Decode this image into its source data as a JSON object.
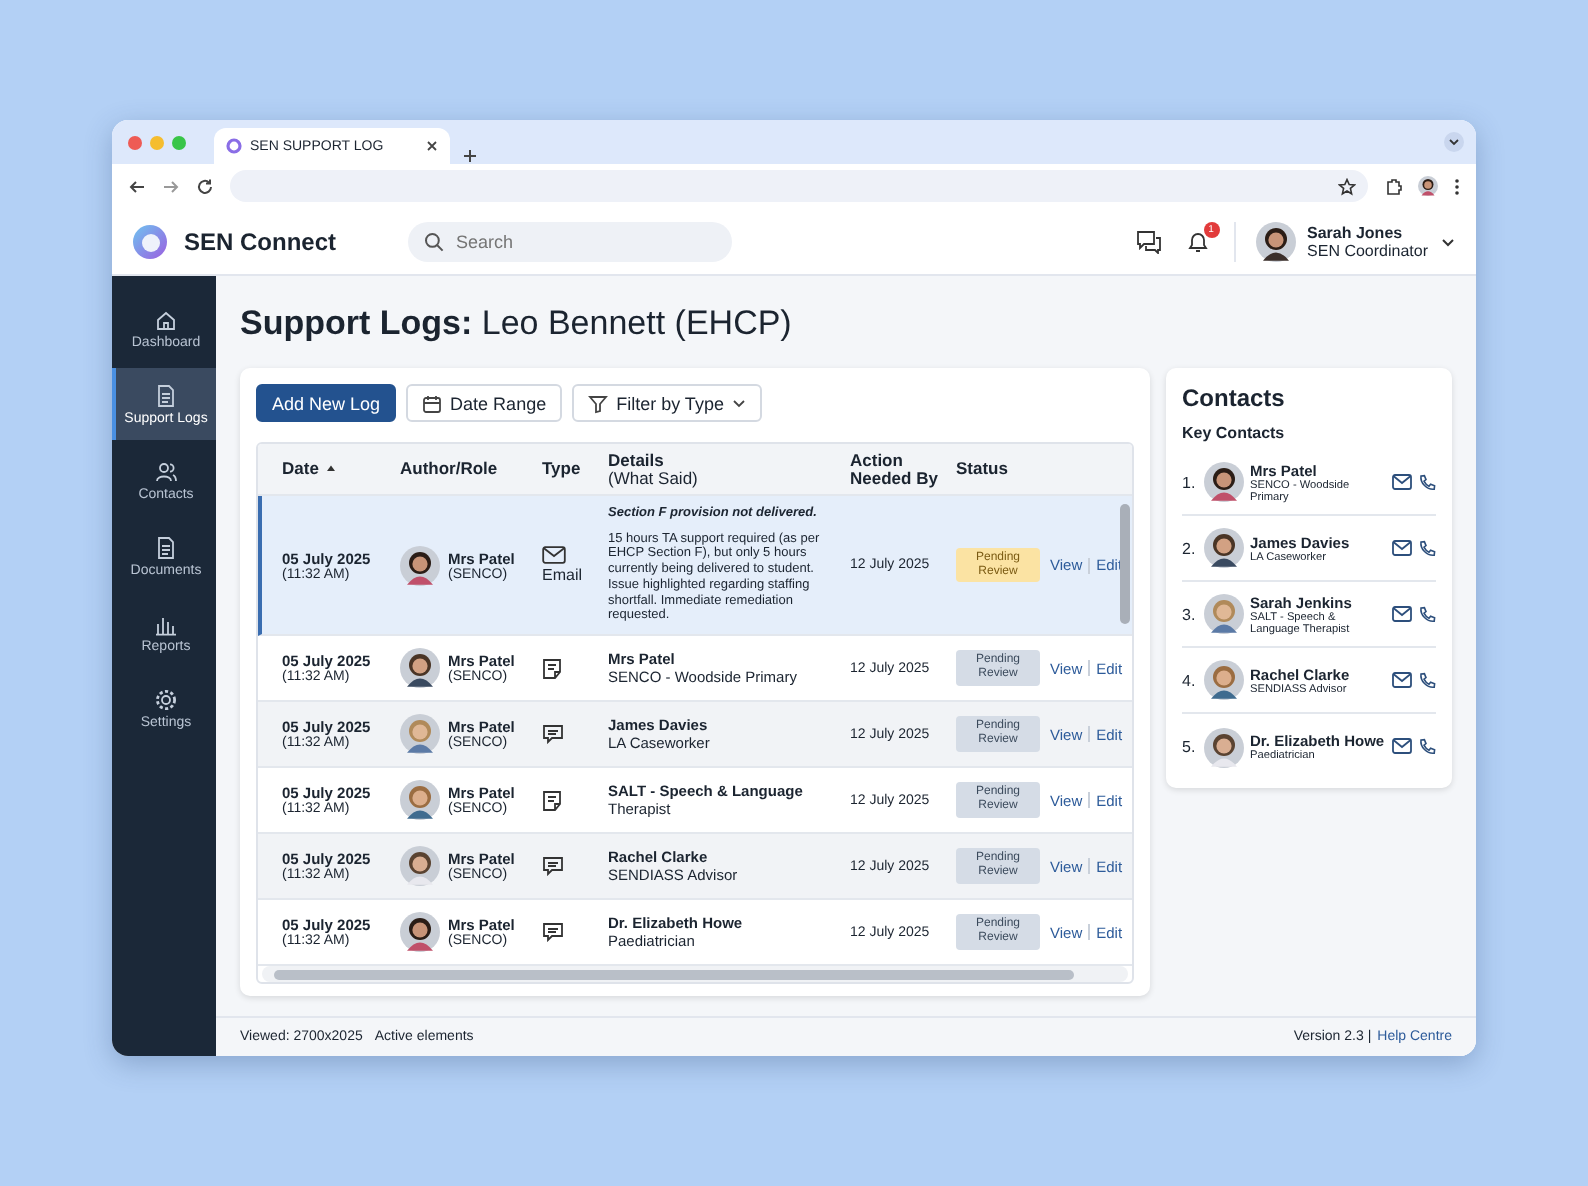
{
  "browser": {
    "tab_title": "SEN SUPPORT LOG"
  },
  "app": {
    "name": "SEN Connect",
    "search": {
      "placeholder": "Search"
    },
    "notifications": "1",
    "user": {
      "name": "Sarah Jones",
      "role": "SEN Coordinator"
    }
  },
  "sidebar": {
    "items": [
      {
        "label": "Dashboard",
        "selected": false
      },
      {
        "label": "Support Logs",
        "selected": true
      },
      {
        "label": "Contacts",
        "selected": false
      },
      {
        "label": "Documents",
        "selected": false
      },
      {
        "label": "Reports",
        "selected": false
      },
      {
        "label": "Settings",
        "selected": false
      }
    ]
  },
  "page": {
    "title_prefix": "Support Logs:",
    "title_name": "Leo Bennett (EHCP)"
  },
  "toolbar": {
    "add": "Add New Log",
    "date_range": "Date Range",
    "filter": "Filter by Type"
  },
  "table": {
    "columns": [
      {
        "label": "Date",
        "sorted": true
      },
      {
        "label": "Author/Role"
      },
      {
        "label": "Type"
      },
      {
        "label": "Details",
        "sub": "(What Said)"
      },
      {
        "label": "Action Needed By"
      },
      {
        "label": "Status"
      }
    ],
    "rows": [
      {
        "selected": true,
        "date": "05 July 2025",
        "time": "(11:32 AM)",
        "author": "Mrs Patel",
        "role": "(SENCO)",
        "kind": "email",
        "type_label": "Email",
        "details_heading": "Section F provision not delivered.",
        "details_text": "15 hours TA support required (as per EHCP Section F), but only 5 hours currently being delivered to student. Issue highlighted regarding staffing shortfall. Immediate remediation requested.",
        "action_by": "12 July 2025",
        "status": "Pending Review",
        "view": "View",
        "edit": "Edit"
      },
      {
        "selected": false,
        "date": "05 July 2025",
        "time": "(11:32 AM)",
        "author": "Mrs Patel",
        "role": "(SENCO)",
        "kind": "note",
        "contact_name": "Mrs Patel",
        "contact_role": "SENCO - Woodside Primary",
        "action_by": "12 July 2025",
        "status": "Pending Review",
        "view": "View",
        "edit": "Edit"
      },
      {
        "selected": false,
        "date": "05 July 2025",
        "time": "(11:32 AM)",
        "author": "Mrs Patel",
        "role": "(SENCO)",
        "kind": "chat",
        "contact_name": "James Davies",
        "contact_role": "LA Caseworker",
        "action_by": "12 July 2025",
        "status": "Pending Review",
        "view": "View",
        "edit": "Edit"
      },
      {
        "selected": false,
        "date": "05 July 2025",
        "time": "(11:32 AM)",
        "author": "Mrs Patel",
        "role": "(SENCO)",
        "kind": "note",
        "contact_name": "SALT - Speech & Language",
        "contact_role": "Therapist",
        "action_by": "12 July 2025",
        "status": "Pending Review",
        "view": "View",
        "edit": "Edit"
      },
      {
        "selected": false,
        "date": "05 July 2025",
        "time": "(11:32 AM)",
        "author": "Mrs Patel",
        "role": "(SENCO)",
        "kind": "chat",
        "contact_name": "Rachel Clarke",
        "contact_role": "SENDIASS Advisor",
        "action_by": "12 July 2025",
        "status": "Pending Review",
        "view": "View",
        "edit": "Edit"
      },
      {
        "selected": false,
        "date": "05 July 2025",
        "time": "(11:32 AM)",
        "author": "Mrs Patel",
        "role": "(SENCO)",
        "kind": "chat",
        "contact_name": "Dr. Elizabeth Howe",
        "contact_role": "Paediatrician",
        "action_by": "12 July 2025",
        "status": "Pending Review",
        "view": "View",
        "edit": "Edit"
      }
    ]
  },
  "contacts": {
    "title": "Contacts",
    "subtitle": "Key Contacts",
    "items": [
      {
        "number": "1.",
        "name": "Mrs Patel",
        "role": "SENCO - Woodside Primary"
      },
      {
        "number": "2.",
        "name": "James Davies",
        "role": "LA Caseworker"
      },
      {
        "number": "3.",
        "name": "Sarah Jenkins",
        "role": "SALT - Speech & Language Therapist"
      },
      {
        "number": "4.",
        "name": "Rachel Clarke",
        "role": "SENDIASS Advisor"
      },
      {
        "number": "5.",
        "name": "Dr. Elizabeth Howe",
        "role": "Paediatrician"
      }
    ]
  },
  "footer": {
    "viewed": "Viewed: 2700x2025",
    "active": "Active elements",
    "version": "Version 2.3 |",
    "help": "Help Centre"
  }
}
